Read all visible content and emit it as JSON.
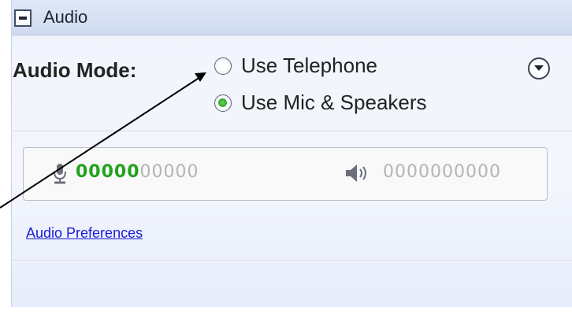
{
  "panel": {
    "title": "Audio",
    "mode_label": "Audio Mode:",
    "options": [
      {
        "label": "Use Telephone",
        "checked": false
      },
      {
        "label": "Use Mic & Speakers",
        "checked": true
      }
    ],
    "dropdown_icon": "chevron-down-circle-icon"
  },
  "levels": {
    "mic_icon": "microphone-icon",
    "mic_active": "00000",
    "mic_inactive": "00000",
    "speaker_icon": "speaker-icon",
    "speaker_level": "0000000000"
  },
  "links": {
    "preferences": "Audio Preferences"
  },
  "colors": {
    "level_active": "#21a31c",
    "level_inactive": "#b4b4b4",
    "link": "#1a1ad8"
  }
}
